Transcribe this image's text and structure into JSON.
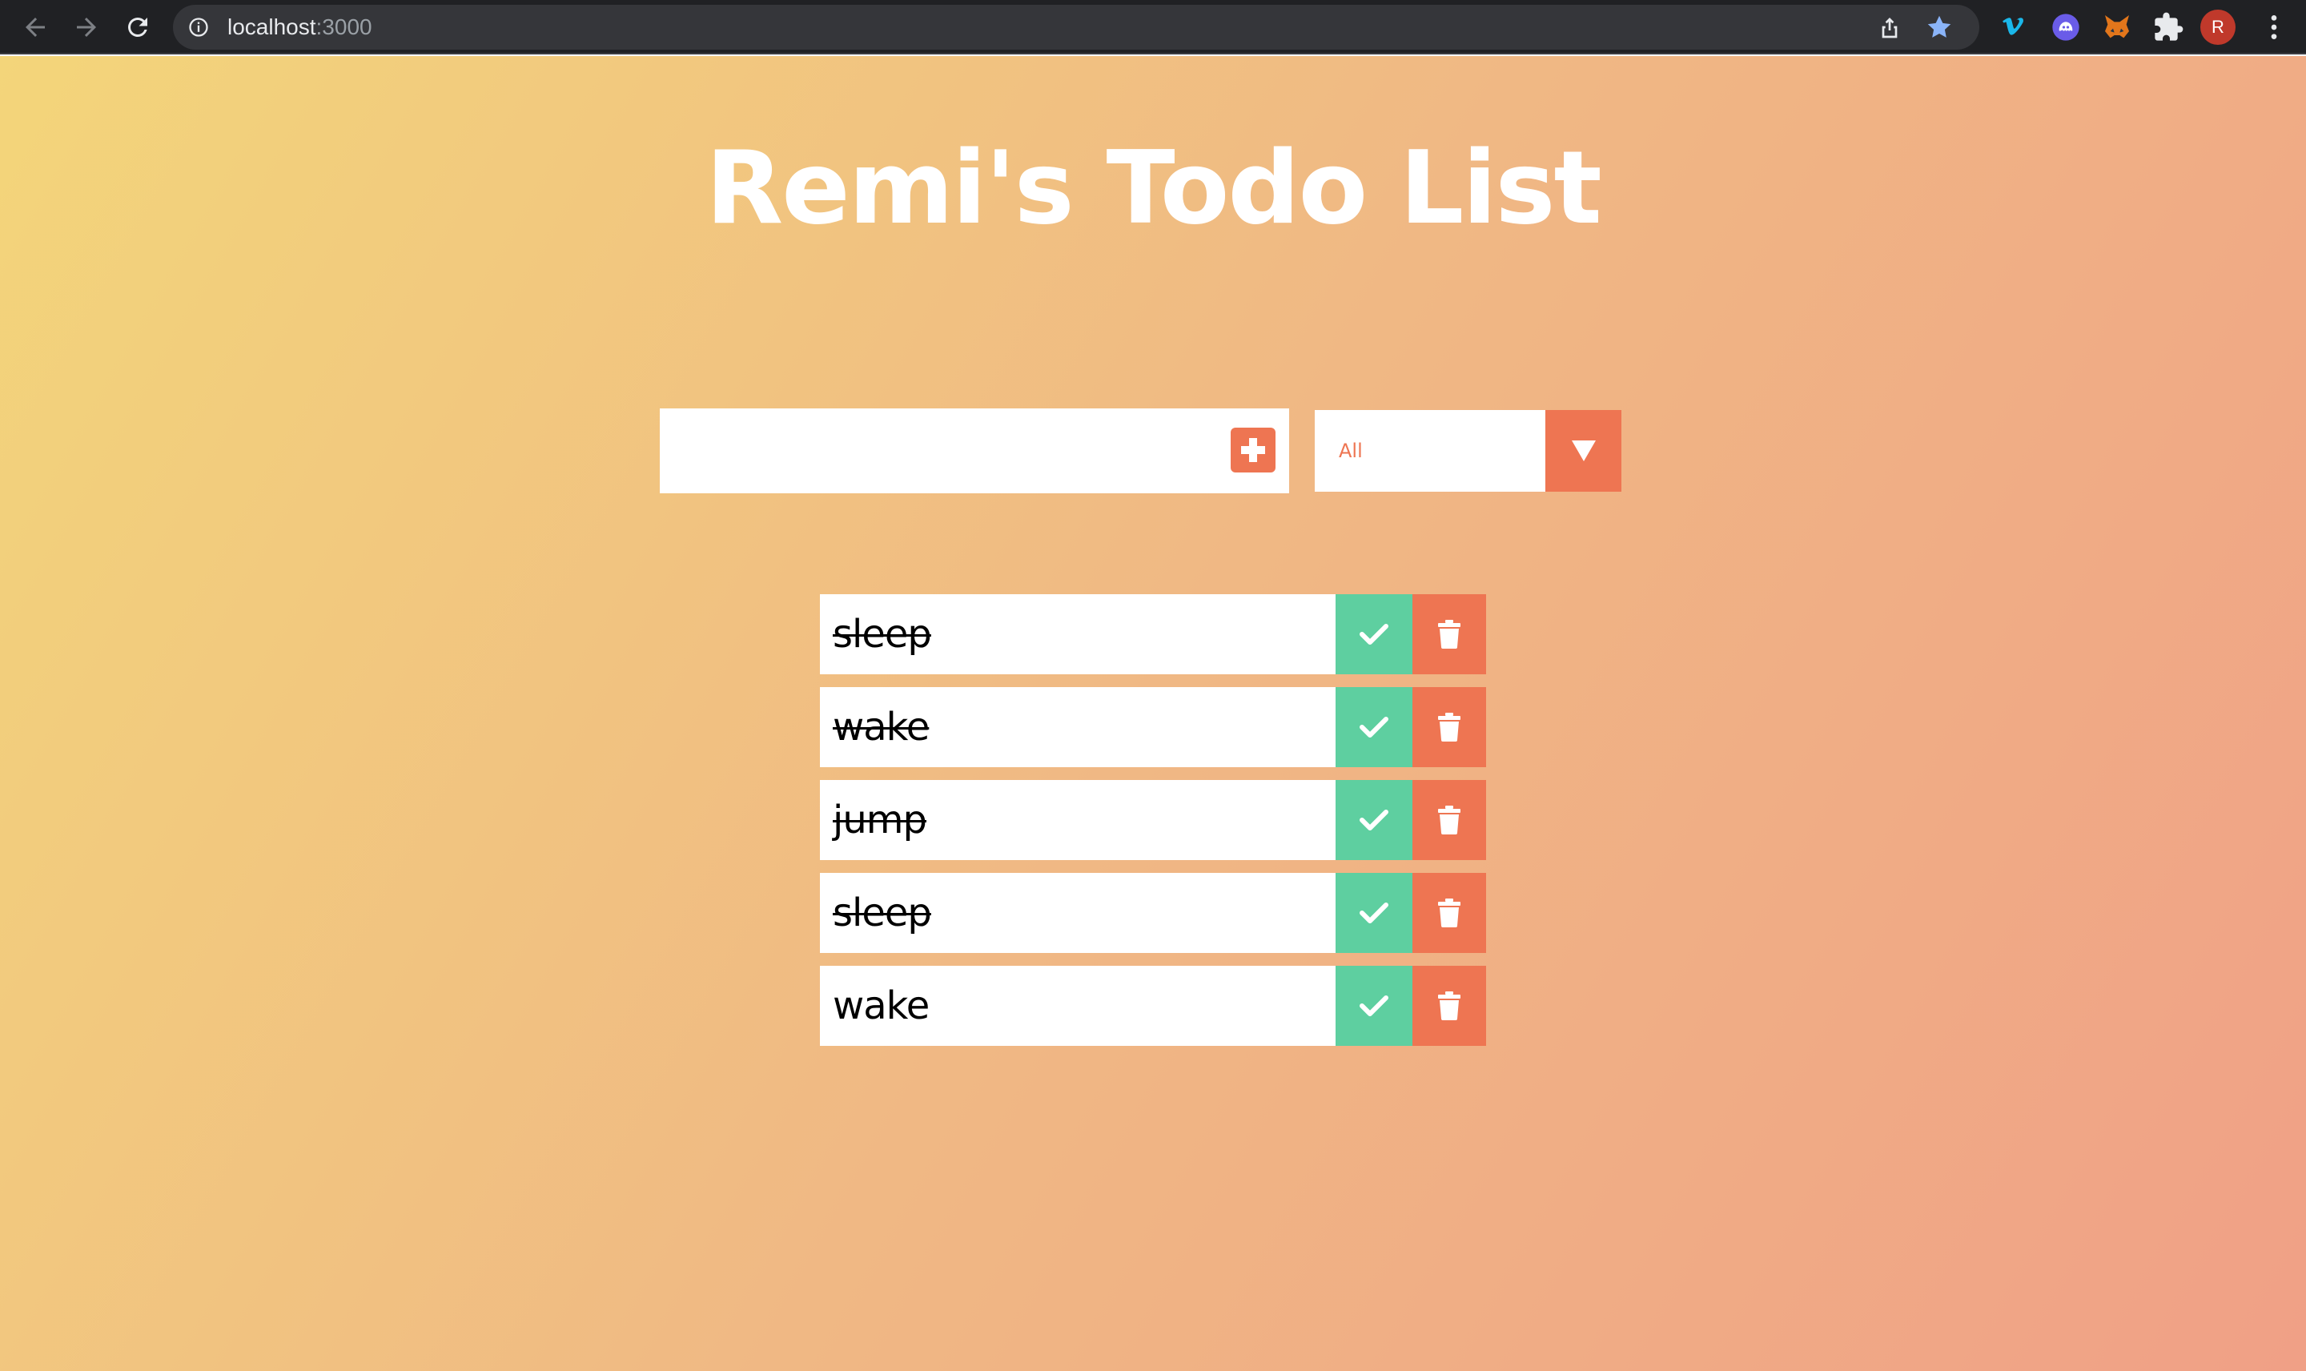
{
  "browser": {
    "url_host": "localhost",
    "url_port": ":3000",
    "avatar_letter": "R",
    "icons": [
      "back-arrow-icon",
      "forward-arrow-icon",
      "reload-icon",
      "info-icon",
      "share-icon",
      "star-icon",
      "vimeo-icon",
      "ghost-extension-icon",
      "metamask-icon",
      "puzzle-extensions-icon",
      "more-menu-icon"
    ]
  },
  "app": {
    "title": "Remi's Todo List",
    "input": {
      "value": "",
      "placeholder": ""
    },
    "filter": {
      "selected": "All"
    },
    "colors": {
      "accent": "#ee7552",
      "complete": "#5ecfa0",
      "text": "#000000"
    },
    "todos": [
      {
        "text": "sleep",
        "completed": true
      },
      {
        "text": "wake",
        "completed": true
      },
      {
        "text": "jump",
        "completed": true
      },
      {
        "text": "sleep",
        "completed": true
      },
      {
        "text": "wake",
        "completed": false
      }
    ]
  }
}
